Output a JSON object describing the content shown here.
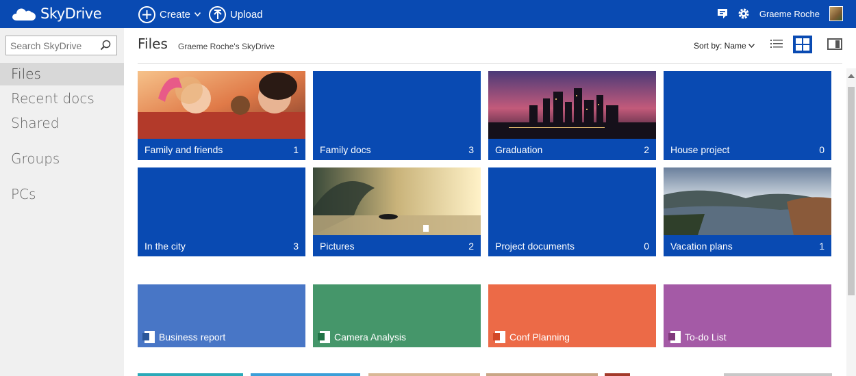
{
  "app": {
    "name": "SkyDrive",
    "colors": {
      "brand": "#094ab2",
      "sidebar": "#f0f0f0",
      "word": "#4876c6",
      "excel": "#45966a",
      "ppt": "#ec6a47",
      "onenote": "#a45aa6"
    }
  },
  "topbar": {
    "create_label": "Create",
    "upload_label": "Upload",
    "user_name": "Graeme Roche"
  },
  "sidebar": {
    "search_placeholder": "Search SkyDrive",
    "items": [
      {
        "label": "Files",
        "active": true
      },
      {
        "label": "Recent docs"
      },
      {
        "label": "Shared"
      },
      {
        "label": "Groups"
      },
      {
        "label": "PCs"
      }
    ]
  },
  "main": {
    "title": "Files",
    "breadcrumb": "Graeme Roche's SkyDrive",
    "sort_label": "Sort by: Name"
  },
  "folders": [
    {
      "name": "Family and friends",
      "count": "1",
      "photo": "people"
    },
    {
      "name": "Family docs",
      "count": "3"
    },
    {
      "name": "Graduation",
      "count": "2",
      "photo": "city"
    },
    {
      "name": "House project",
      "count": "0"
    },
    {
      "name": "In the city",
      "count": "3"
    },
    {
      "name": "Pictures",
      "count": "2",
      "photo": "surf"
    },
    {
      "name": "Project documents",
      "count": "0"
    },
    {
      "name": "Vacation plans",
      "count": "1",
      "photo": "gorge"
    }
  ],
  "documents": [
    {
      "name": "Business report",
      "type": "word"
    },
    {
      "name": "Camera Analysis",
      "type": "excel"
    },
    {
      "name": "Conf Planning",
      "type": "powerpoint"
    },
    {
      "name": "To-do List",
      "type": "onenote"
    }
  ]
}
